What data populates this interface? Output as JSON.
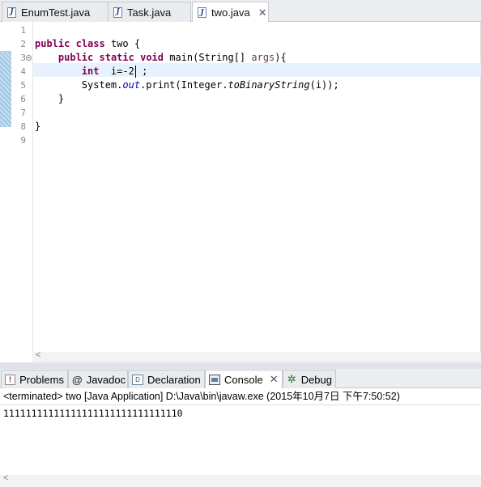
{
  "editor_tabs": [
    {
      "label": "EnumTest.java",
      "icon": "java-file-icon",
      "active": false
    },
    {
      "label": "Task.java",
      "icon": "java-file-icon",
      "active": false
    },
    {
      "label": "two.java",
      "icon": "java-file-icon",
      "active": true
    }
  ],
  "line_numbers": [
    "1",
    "2",
    "3",
    "4",
    "5",
    "6",
    "7",
    "8",
    "9"
  ],
  "code": {
    "line2": {
      "kw1": "public",
      "kw2": "class",
      "rest": " two {"
    },
    "line3": {
      "kw1": "public",
      "kw2": "static",
      "kw3": "void",
      "name": " main(String[] ",
      "param": "args",
      "end": "){"
    },
    "line4": {
      "kw": "int",
      "decl": "  i=-2",
      "end": " ;"
    },
    "line5": {
      "pre": "System.",
      "field": "out",
      "mid": ".print(Integer.",
      "method": "toBinaryString",
      "end": "(i));"
    },
    "line6": "}",
    "line8": "}"
  },
  "view_tabs": [
    {
      "label": "Problems",
      "icon": "problems-icon"
    },
    {
      "label": "Javadoc",
      "icon": "javadoc-icon"
    },
    {
      "label": "Declaration",
      "icon": "declaration-icon"
    },
    {
      "label": "Console",
      "icon": "console-icon",
      "active": true
    },
    {
      "label": "Debug",
      "icon": "debug-icon"
    }
  ],
  "console": {
    "status": "<terminated> two [Java Application] D:\\Java\\bin\\javaw.exe (2015年10月7日 下午7:50:52)",
    "output": "11111111111111111111111111111110"
  },
  "colors": {
    "keyword": "#7f0055",
    "field": "#0000c0",
    "parameter": "#6a3e3e",
    "current_line": "#e8f2fe"
  }
}
